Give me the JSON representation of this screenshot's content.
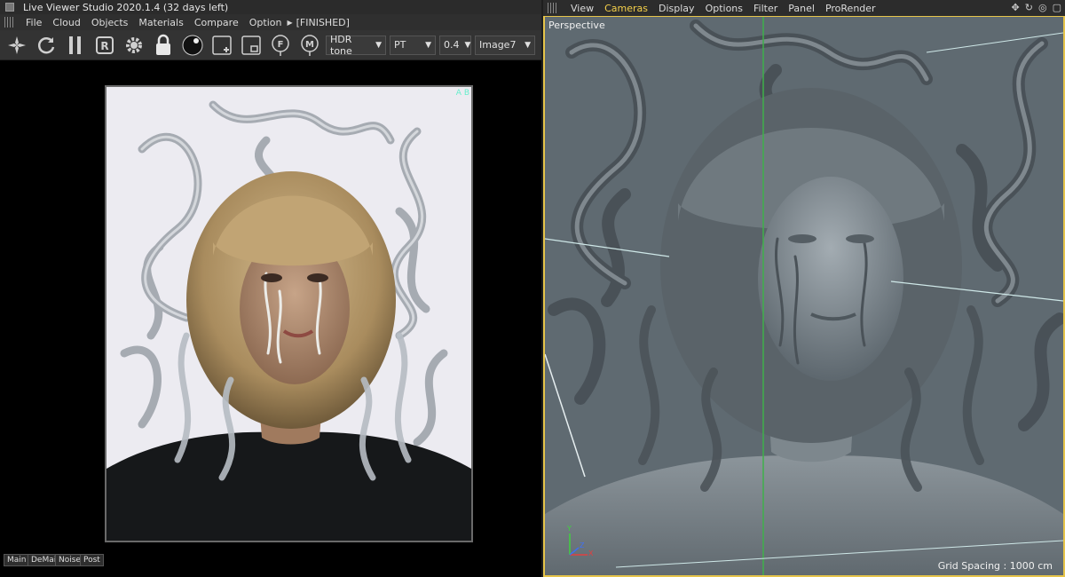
{
  "live_viewer": {
    "title": "Live Viewer Studio 2020.1.4 (32 days left)",
    "menu": [
      "File",
      "Cloud",
      "Objects",
      "Materials",
      "Compare",
      "Option"
    ],
    "status": "[FINISHED]",
    "toolbar": {
      "tone_select": "HDR tone",
      "kernel_select": "PT",
      "value_select": "0.4",
      "image_select": "Image7"
    },
    "ab_label": "A B",
    "bottom_tabs": [
      "Main",
      "DeMain",
      "Noise",
      "Post"
    ]
  },
  "viewport": {
    "menu": [
      "View",
      "Cameras",
      "Display",
      "Options",
      "Filter",
      "Panel",
      "ProRender"
    ],
    "active_menu": "Cameras",
    "camera_label": "Perspective",
    "grid_spacing": "Grid Spacing : 1000 cm",
    "axis_x": "X",
    "axis_y": "Y",
    "axis_z": "Z",
    "colors": {
      "active_menu": "#f5d04a",
      "view_border": "#e6c44a",
      "viewport_bg": "#5f6a71",
      "axis_x": "#e04040",
      "axis_y": "#40d040",
      "axis_z": "#4070f0"
    }
  },
  "icons": [
    "nav-icon",
    "refresh-icon",
    "pause-icon",
    "region-icon",
    "settings-icon",
    "lock-icon",
    "material-ball-icon",
    "add-region-icon",
    "focus-icon",
    "film-pin-icon",
    "marker-pin-icon",
    "move-icon",
    "rotate-icon",
    "zoom-icon",
    "maximize-icon"
  ]
}
